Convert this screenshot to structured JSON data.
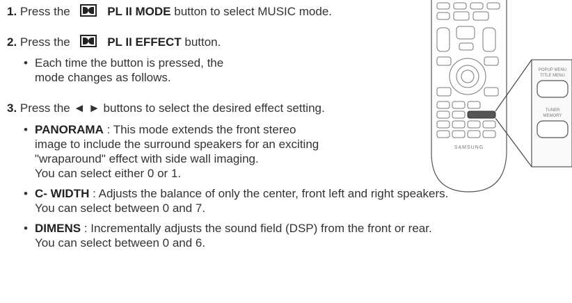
{
  "steps": [
    {
      "num": "1.",
      "pre": "Press the",
      "button": "PL II MODE",
      "post": "button to select MUSIC mode."
    },
    {
      "num": "2.",
      "pre": "Press the",
      "button": "PL II EFFECT",
      "post": "button.",
      "bullets": [
        "Each time the button is pressed, the mode changes as follows."
      ]
    },
    {
      "num": "3.",
      "text": "Press the ◄ ► buttons to select the desired effect setting.",
      "items": [
        {
          "term": "PANORAMA",
          "desc1": " : This mode extends the front stereo",
          "desc2": "image to include the surround speakers for an exciting",
          "desc3": "\"wraparound\" effect with side wall imaging.",
          "desc4": "You can select either 0 or 1."
        },
        {
          "term": "C- WIDTH",
          "desc1": " : Adjusts the balance of only the center, front left and right speakers.",
          "desc2": "You can select between 0 and 7."
        },
        {
          "term": "DIMENS",
          "desc1": " : Incrementally adjusts the sound field (DSP) from the front or rear.",
          "desc2": "You can select between 0 and 6."
        }
      ]
    }
  ],
  "remote": {
    "brand": "SAMSUNG",
    "callout_top": "POPUP MENU",
    "callout_top2": "TITLE MENU",
    "callout_bottom": "TUNER",
    "callout_bottom2": "MEMORY"
  }
}
